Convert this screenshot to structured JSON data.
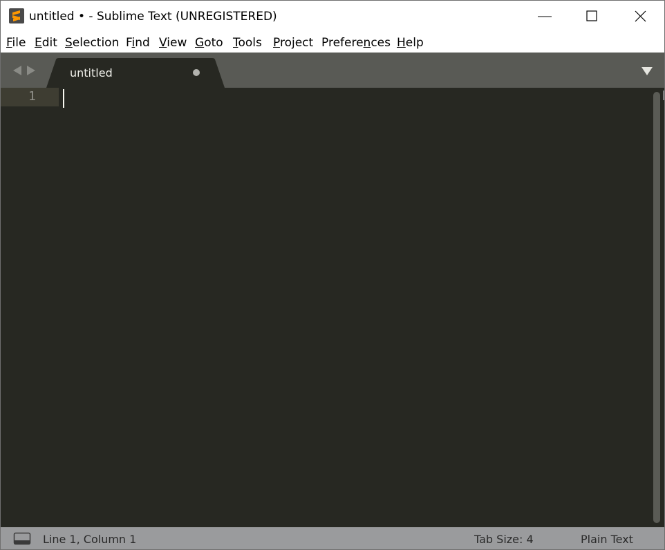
{
  "window": {
    "title": "untitled • - Sublime Text (UNREGISTERED)"
  },
  "menu": {
    "items": [
      {
        "pre": "",
        "ul": "F",
        "post": "ile"
      },
      {
        "pre": "",
        "ul": "E",
        "post": "dit"
      },
      {
        "pre": "",
        "ul": "S",
        "post": "election"
      },
      {
        "pre": "F",
        "ul": "i",
        "post": "nd"
      },
      {
        "pre": "",
        "ul": "V",
        "post": "iew"
      },
      {
        "pre": "",
        "ul": "G",
        "post": "oto"
      },
      {
        "pre": "",
        "ul": "T",
        "post": "ools"
      },
      {
        "pre": "",
        "ul": "P",
        "post": "roject"
      },
      {
        "pre": "Prefere",
        "ul": "n",
        "post": "ces"
      },
      {
        "pre": "",
        "ul": "H",
        "post": "elp"
      }
    ]
  },
  "tabs": {
    "active": {
      "label": "untitled",
      "dirty": true
    }
  },
  "editor": {
    "line_numbers": [
      "1"
    ],
    "background": "#272822",
    "gutter_highlight": "#3e3d32"
  },
  "statusbar": {
    "position": "Line 1, Column 1",
    "tab_size": "Tab Size: 4",
    "syntax": "Plain Text",
    "background": "#9a9b9d"
  },
  "icons": {
    "app": "sublime-text-logo-icon",
    "minimize": "minimize-icon",
    "maximize": "maximize-icon",
    "close": "close-icon",
    "nav_back": "arrow-left-icon",
    "nav_forward": "arrow-right-icon",
    "tab_list": "triangle-down-icon",
    "panel": "panel-switcher-icon"
  }
}
